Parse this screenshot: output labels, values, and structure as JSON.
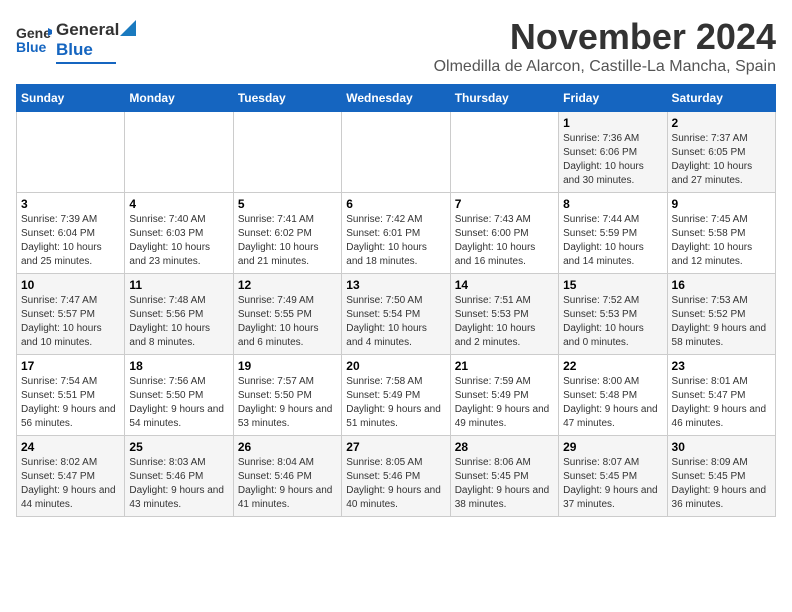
{
  "header": {
    "logo_general": "General",
    "logo_blue": "Blue",
    "month": "November 2024",
    "location": "Olmedilla de Alarcon, Castille-La Mancha, Spain"
  },
  "weekdays": [
    "Sunday",
    "Monday",
    "Tuesday",
    "Wednesday",
    "Thursday",
    "Friday",
    "Saturday"
  ],
  "weeks": [
    [
      {
        "day": "",
        "info": ""
      },
      {
        "day": "",
        "info": ""
      },
      {
        "day": "",
        "info": ""
      },
      {
        "day": "",
        "info": ""
      },
      {
        "day": "",
        "info": ""
      },
      {
        "day": "1",
        "info": "Sunrise: 7:36 AM\nSunset: 6:06 PM\nDaylight: 10 hours and 30 minutes."
      },
      {
        "day": "2",
        "info": "Sunrise: 7:37 AM\nSunset: 6:05 PM\nDaylight: 10 hours and 27 minutes."
      }
    ],
    [
      {
        "day": "3",
        "info": "Sunrise: 7:39 AM\nSunset: 6:04 PM\nDaylight: 10 hours and 25 minutes."
      },
      {
        "day": "4",
        "info": "Sunrise: 7:40 AM\nSunset: 6:03 PM\nDaylight: 10 hours and 23 minutes."
      },
      {
        "day": "5",
        "info": "Sunrise: 7:41 AM\nSunset: 6:02 PM\nDaylight: 10 hours and 21 minutes."
      },
      {
        "day": "6",
        "info": "Sunrise: 7:42 AM\nSunset: 6:01 PM\nDaylight: 10 hours and 18 minutes."
      },
      {
        "day": "7",
        "info": "Sunrise: 7:43 AM\nSunset: 6:00 PM\nDaylight: 10 hours and 16 minutes."
      },
      {
        "day": "8",
        "info": "Sunrise: 7:44 AM\nSunset: 5:59 PM\nDaylight: 10 hours and 14 minutes."
      },
      {
        "day": "9",
        "info": "Sunrise: 7:45 AM\nSunset: 5:58 PM\nDaylight: 10 hours and 12 minutes."
      }
    ],
    [
      {
        "day": "10",
        "info": "Sunrise: 7:47 AM\nSunset: 5:57 PM\nDaylight: 10 hours and 10 minutes."
      },
      {
        "day": "11",
        "info": "Sunrise: 7:48 AM\nSunset: 5:56 PM\nDaylight: 10 hours and 8 minutes."
      },
      {
        "day": "12",
        "info": "Sunrise: 7:49 AM\nSunset: 5:55 PM\nDaylight: 10 hours and 6 minutes."
      },
      {
        "day": "13",
        "info": "Sunrise: 7:50 AM\nSunset: 5:54 PM\nDaylight: 10 hours and 4 minutes."
      },
      {
        "day": "14",
        "info": "Sunrise: 7:51 AM\nSunset: 5:53 PM\nDaylight: 10 hours and 2 minutes."
      },
      {
        "day": "15",
        "info": "Sunrise: 7:52 AM\nSunset: 5:53 PM\nDaylight: 10 hours and 0 minutes."
      },
      {
        "day": "16",
        "info": "Sunrise: 7:53 AM\nSunset: 5:52 PM\nDaylight: 9 hours and 58 minutes."
      }
    ],
    [
      {
        "day": "17",
        "info": "Sunrise: 7:54 AM\nSunset: 5:51 PM\nDaylight: 9 hours and 56 minutes."
      },
      {
        "day": "18",
        "info": "Sunrise: 7:56 AM\nSunset: 5:50 PM\nDaylight: 9 hours and 54 minutes."
      },
      {
        "day": "19",
        "info": "Sunrise: 7:57 AM\nSunset: 5:50 PM\nDaylight: 9 hours and 53 minutes."
      },
      {
        "day": "20",
        "info": "Sunrise: 7:58 AM\nSunset: 5:49 PM\nDaylight: 9 hours and 51 minutes."
      },
      {
        "day": "21",
        "info": "Sunrise: 7:59 AM\nSunset: 5:49 PM\nDaylight: 9 hours and 49 minutes."
      },
      {
        "day": "22",
        "info": "Sunrise: 8:00 AM\nSunset: 5:48 PM\nDaylight: 9 hours and 47 minutes."
      },
      {
        "day": "23",
        "info": "Sunrise: 8:01 AM\nSunset: 5:47 PM\nDaylight: 9 hours and 46 minutes."
      }
    ],
    [
      {
        "day": "24",
        "info": "Sunrise: 8:02 AM\nSunset: 5:47 PM\nDaylight: 9 hours and 44 minutes."
      },
      {
        "day": "25",
        "info": "Sunrise: 8:03 AM\nSunset: 5:46 PM\nDaylight: 9 hours and 43 minutes."
      },
      {
        "day": "26",
        "info": "Sunrise: 8:04 AM\nSunset: 5:46 PM\nDaylight: 9 hours and 41 minutes."
      },
      {
        "day": "27",
        "info": "Sunrise: 8:05 AM\nSunset: 5:46 PM\nDaylight: 9 hours and 40 minutes."
      },
      {
        "day": "28",
        "info": "Sunrise: 8:06 AM\nSunset: 5:45 PM\nDaylight: 9 hours and 38 minutes."
      },
      {
        "day": "29",
        "info": "Sunrise: 8:07 AM\nSunset: 5:45 PM\nDaylight: 9 hours and 37 minutes."
      },
      {
        "day": "30",
        "info": "Sunrise: 8:09 AM\nSunset: 5:45 PM\nDaylight: 9 hours and 36 minutes."
      }
    ]
  ]
}
